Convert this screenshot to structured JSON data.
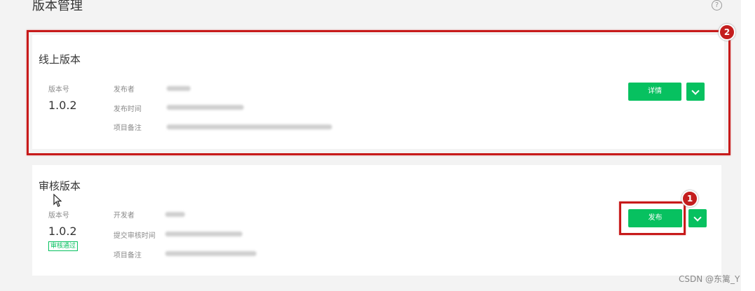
{
  "page": {
    "title": "版本管理",
    "help_icon": "?"
  },
  "online_version": {
    "title": "线上版本",
    "version_label": "版本号",
    "version": "1.0.2",
    "field_labels": [
      "发布者",
      "发布时间",
      "项目备注"
    ],
    "details_button": "详情"
  },
  "review_version": {
    "title": "审核版本",
    "version_label": "版本号",
    "version": "1.0.2",
    "status_badge": "审核通过",
    "field_labels": [
      "开发者",
      "提交审核时间",
      "项目备注"
    ],
    "publish_button": "发布"
  },
  "annotations": {
    "marker_1": "1",
    "marker_2": "2"
  },
  "watermark": "CSDN @东篱_Y",
  "colors": {
    "accent": "#07c160",
    "annotation_red": "#c71a1a"
  }
}
